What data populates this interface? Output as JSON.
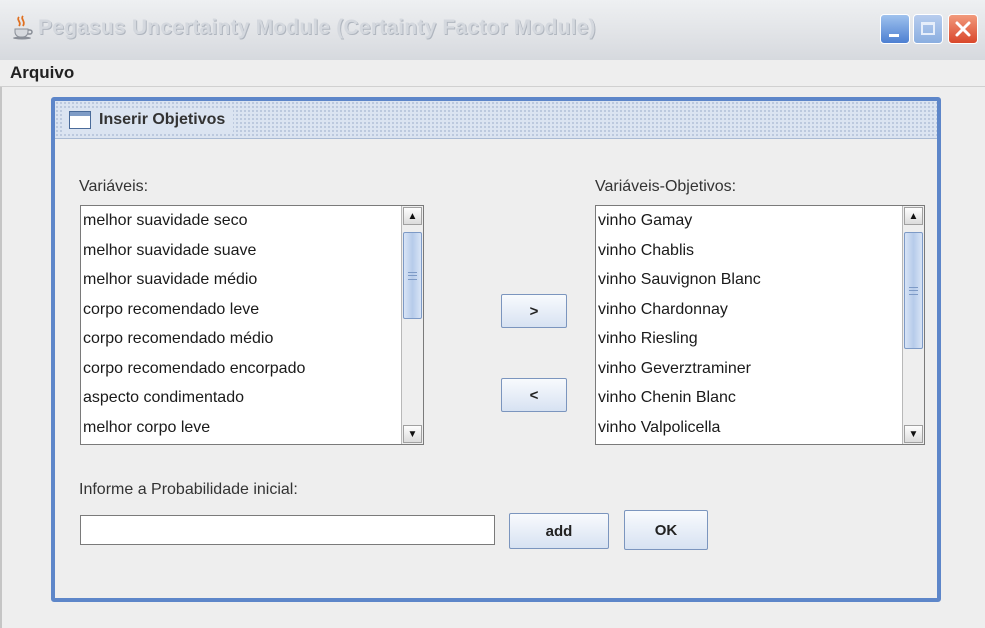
{
  "window": {
    "title": "Pegasus Uncertainty Module (Certainty Factor Module)",
    "title_icon": "java-cup-icon"
  },
  "menubar": {
    "items": [
      {
        "label": "Arquivo"
      }
    ]
  },
  "dialog": {
    "title": "Inserir Objetivos",
    "variables_label": "Variáveis:",
    "goals_label": "Variáveis-Objetivos:",
    "variables": [
      "melhor suavidade seco",
      "melhor suavidade suave",
      "melhor suavidade médio",
      "corpo recomendado leve",
      "corpo recomendado médio",
      "corpo recomendado encorpado",
      "aspecto condimentado",
      "melhor corpo leve"
    ],
    "goals": [
      "vinho Gamay",
      "vinho Chablis",
      "vinho Sauvignon Blanc",
      "vinho Chardonnay",
      "vinho Riesling",
      "vinho Geverztraminer",
      "vinho Chenin Blanc",
      "vinho Valpolicella"
    ],
    "move_right_label": ">",
    "move_left_label": "<",
    "probability_label": "Informe a Probabilidade inicial:",
    "probability_value": "",
    "add_label": "add",
    "ok_label": "OK"
  },
  "colors": {
    "frame_border": "#5d86c9",
    "close_button": "#d9472b",
    "scroll_thumb": "#b6cbea"
  }
}
